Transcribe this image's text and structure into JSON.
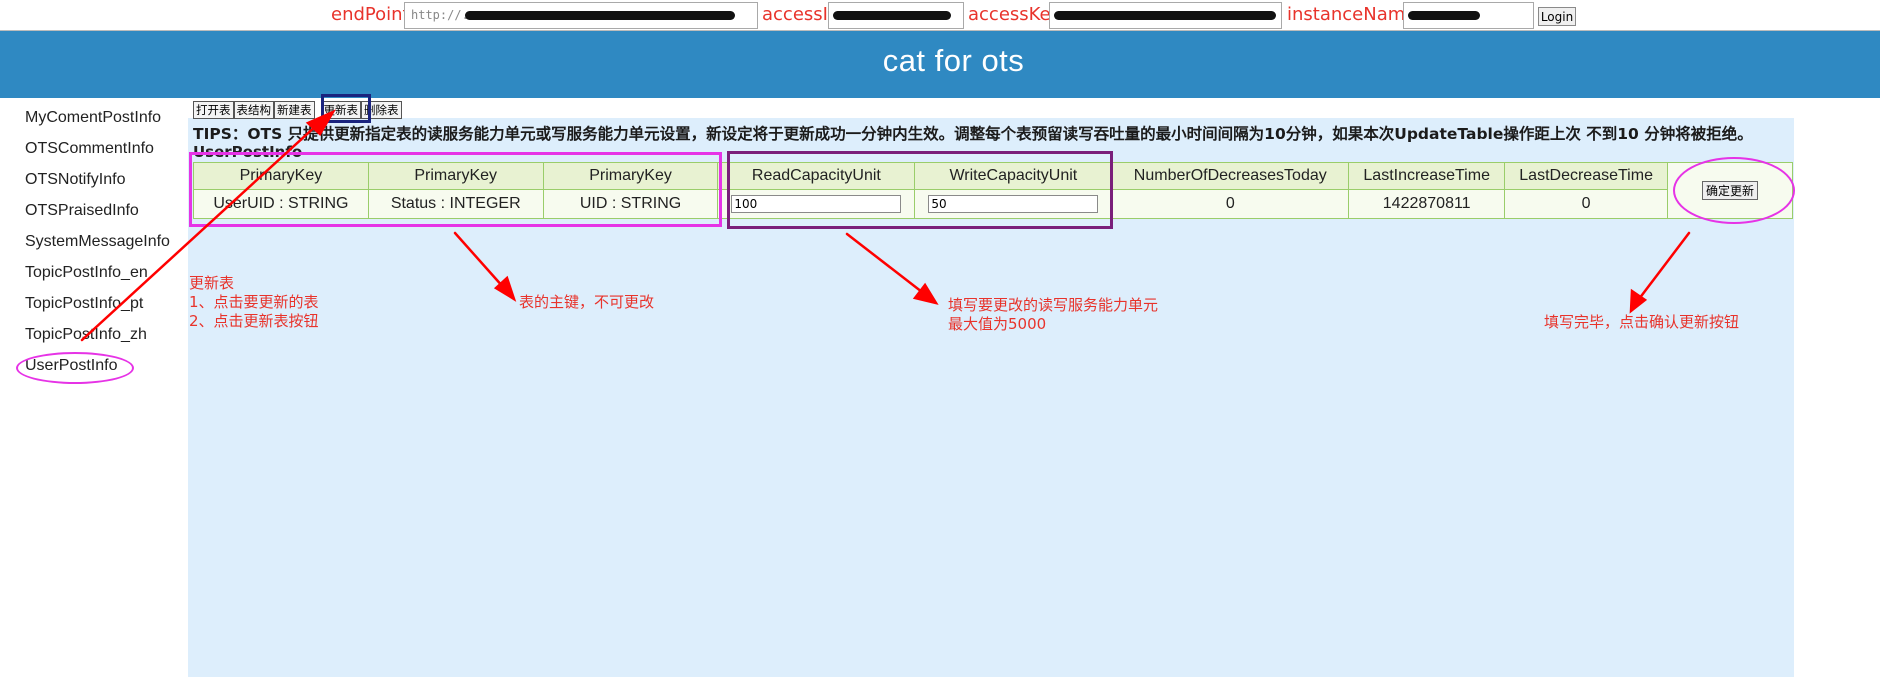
{
  "login": {
    "endpoint_label": "endPoint:",
    "endpoint_value": "http://...",
    "accessid_label": "accessId:",
    "accessid_value": "",
    "accesskey_label": "accessKey:",
    "accesskey_value": "",
    "instance_label": "instanceName:",
    "instance_value": "",
    "login_label": "Login"
  },
  "header": {
    "title": "cat for ots"
  },
  "sidebar": {
    "items": [
      {
        "label": "MyComentPostInfo"
      },
      {
        "label": "OTSCommentInfo"
      },
      {
        "label": "OTSNotifyInfo"
      },
      {
        "label": "OTSPraisedInfo"
      },
      {
        "label": "SystemMessageInfo"
      },
      {
        "label": "TopicPostInfo_en"
      },
      {
        "label": "TopicPostInfo_pt"
      },
      {
        "label": "TopicPostInfo_zh"
      },
      {
        "label": "UserPostInfo"
      }
    ]
  },
  "toolbar": {
    "open_label": "打开表",
    "structure_label": "表结构",
    "create_label": "新建表",
    "update_label": "更新表",
    "delete_label": "删除表"
  },
  "tips": "TIPS：OTS 只提供更新指定表的读服务能力单元或写服务能力单元设置，新设定将于更新成功一分钟内生效。调整每个表预留读写吞吐量的最小时间间隔为10分钟，如果本次UpdateTable操作距上次 不到10 分钟将被拒绝。",
  "table": {
    "title": "UserPostInfo",
    "headers": [
      "PrimaryKey",
      "PrimaryKey",
      "PrimaryKey",
      "ReadCapacityUnit",
      "WriteCapacityUnit",
      "NumberOfDecreasesToday",
      "LastIncreaseTime",
      "LastDecreaseTime"
    ],
    "row": {
      "pk1": "UserUID : STRING",
      "pk2": "Status : INTEGER",
      "pk3": "UID : STRING",
      "read_capacity": "100",
      "write_capacity": "50",
      "decreases_today": "0",
      "last_increase": "1422870811",
      "last_decrease": "0"
    },
    "confirm_label": "确定更新"
  },
  "annotations": {
    "update_note_1": "更新表",
    "update_note_2": "1、点击要更新的表",
    "update_note_3": "2、点击更新表按钮",
    "pk_note": "表的主键，不可更改",
    "capacity_note_1": "填写要更改的读写服务能力单元",
    "capacity_note_2": "最大值为5000",
    "confirm_note": "填写完毕，点击确认更新按钮",
    "arrow_color": "#ff0000",
    "pink_color": "#e633e6",
    "navy_color": "#1a237e",
    "purple_color": "#7a1f7a"
  }
}
